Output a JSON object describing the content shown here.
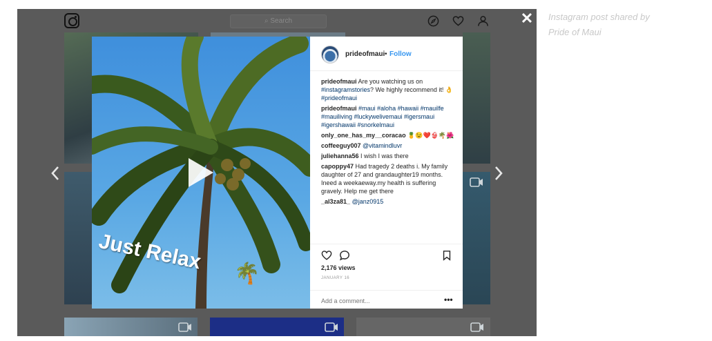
{
  "app": {
    "search_placeholder": "Search",
    "close_glyph": "✕",
    "icons": [
      "instagram-logo",
      "compass-icon",
      "heart-icon",
      "person-icon",
      "video-camera-icon",
      "chevron-left-icon",
      "chevron-right-icon"
    ]
  },
  "post": {
    "username": "prideofmaui",
    "dot": "•",
    "follow_label": "Follow",
    "overlay_text": "Just Relax",
    "overlay_emoji": "🌴",
    "comments": [
      {
        "user": "prideofmaui",
        "text": "Are you watching us on",
        "tag1": "#instagramstories",
        "text2": "? We highly recommend it! 👌",
        "tag2": "#prideofmaui"
      },
      {
        "user": "prideofmaui",
        "tags": "#maui #aloha #hawaii #mauilfe #mauiliving #luckywelivemaui #igersmaui #igershawaii #snorkelmaui"
      },
      {
        "user": "only_one_has_my__coracao",
        "text": "🍍😉❤️👙🌴🌺"
      },
      {
        "user": "coffeeguy007",
        "mention": "@vitamindluvr"
      },
      {
        "user": "juliehanna56",
        "text": "I wish I was there"
      },
      {
        "user": "capoppy47",
        "text": "Had tragedy 2 deaths i. My family daughter of 27 and grandaughter19 months. Ineed a weekaeway.my health is suffering gravely. Help me get there"
      },
      {
        "user": "_al3za81_",
        "mention": "@janz0915"
      }
    ],
    "views": "2,176 views",
    "date": "JANUARY 16",
    "add_comment_placeholder": "Add a comment...",
    "more_glyph": "•••"
  },
  "caption": {
    "line1": "Instagram post shared by",
    "line2": "Pride of Maui"
  }
}
